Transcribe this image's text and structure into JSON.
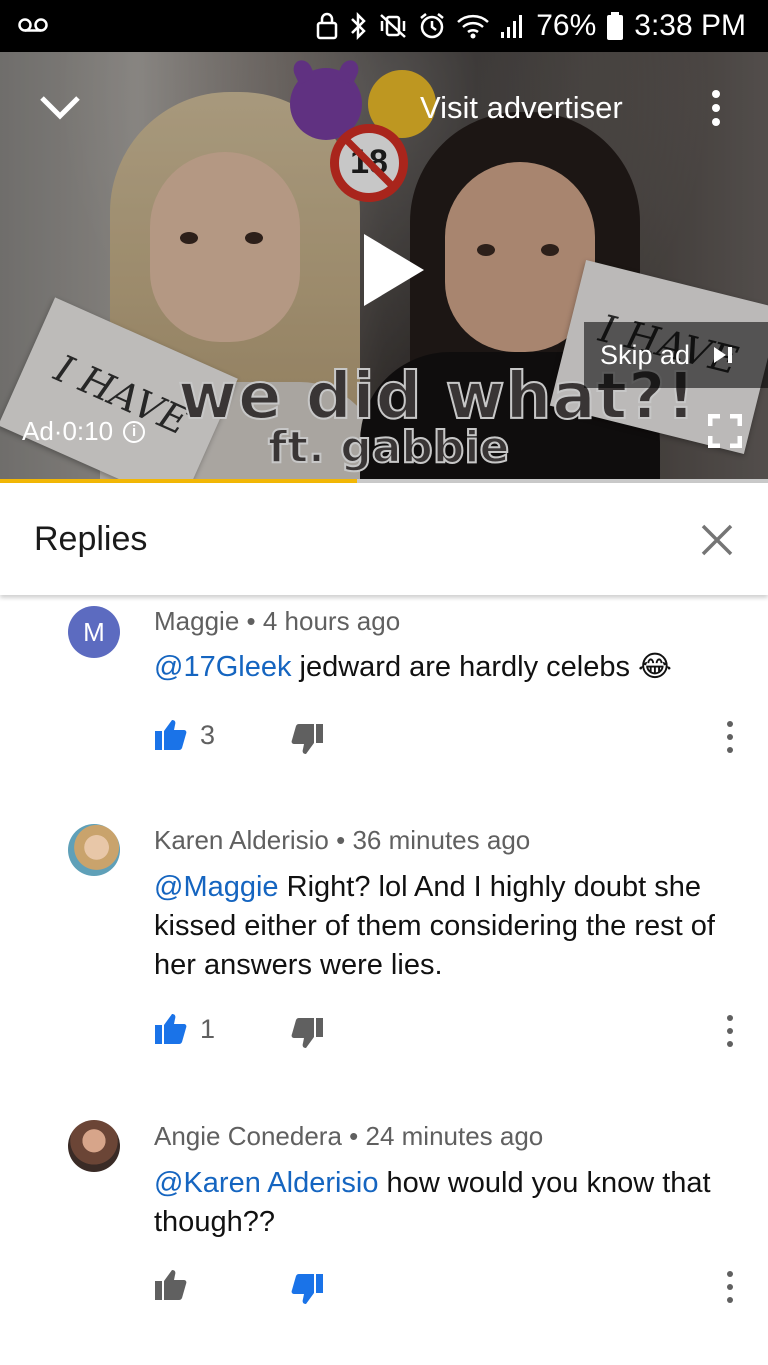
{
  "status_bar": {
    "battery": "76%",
    "time": "3:38 PM"
  },
  "video": {
    "visit_advertiser": "Visit advertiser",
    "skip_ad": "Skip ad",
    "ad_time": "Ad·0:10",
    "card_text": "I HAVE",
    "title_main": "we did what?!",
    "title_sub": "ft. gabbie",
    "badge_18": "18",
    "progress": 0.465,
    "progress_color": "#f2b705"
  },
  "replies": {
    "title": "Replies"
  },
  "comments": [
    {
      "avatar_letter": "M",
      "author": "Maggie",
      "time": "4 hours ago",
      "mention": "@17Gleek",
      "text": " jedward are hardly celebs",
      "emoji": "😂",
      "likes": "3",
      "liked": true,
      "disliked": false
    },
    {
      "avatar_letter": "",
      "author": "Karen Alderisio",
      "time": "36 minutes ago",
      "mention": "@Maggie",
      "text": " Right? lol And I highly doubt she kissed either of them considering the rest of her answers were lies.",
      "emoji": "",
      "likes": "1",
      "liked": true,
      "disliked": false
    },
    {
      "avatar_letter": "",
      "author": "Angie Conedera",
      "time": "24 minutes ago",
      "mention": "@Karen Alderisio",
      "text": " how would you know that though??",
      "emoji": "",
      "likes": "",
      "liked": false,
      "disliked": true
    }
  ],
  "colors": {
    "link_blue": "#1565c0",
    "active_blue": "#1a73e8",
    "inactive_gray": "#606060",
    "avatar_purple": "#5c6bc0"
  },
  "icons": {
    "voicemail": "voicemail-icon",
    "collapse": "chevron-down-icon",
    "more": "more-vert-icon",
    "play": "play-icon",
    "skip": "skip-next-icon",
    "info": "info-icon",
    "fullscreen": "fullscreen-icon",
    "close": "close-icon",
    "like": "thumbs-up-icon",
    "dislike": "thumbs-down-icon"
  }
}
